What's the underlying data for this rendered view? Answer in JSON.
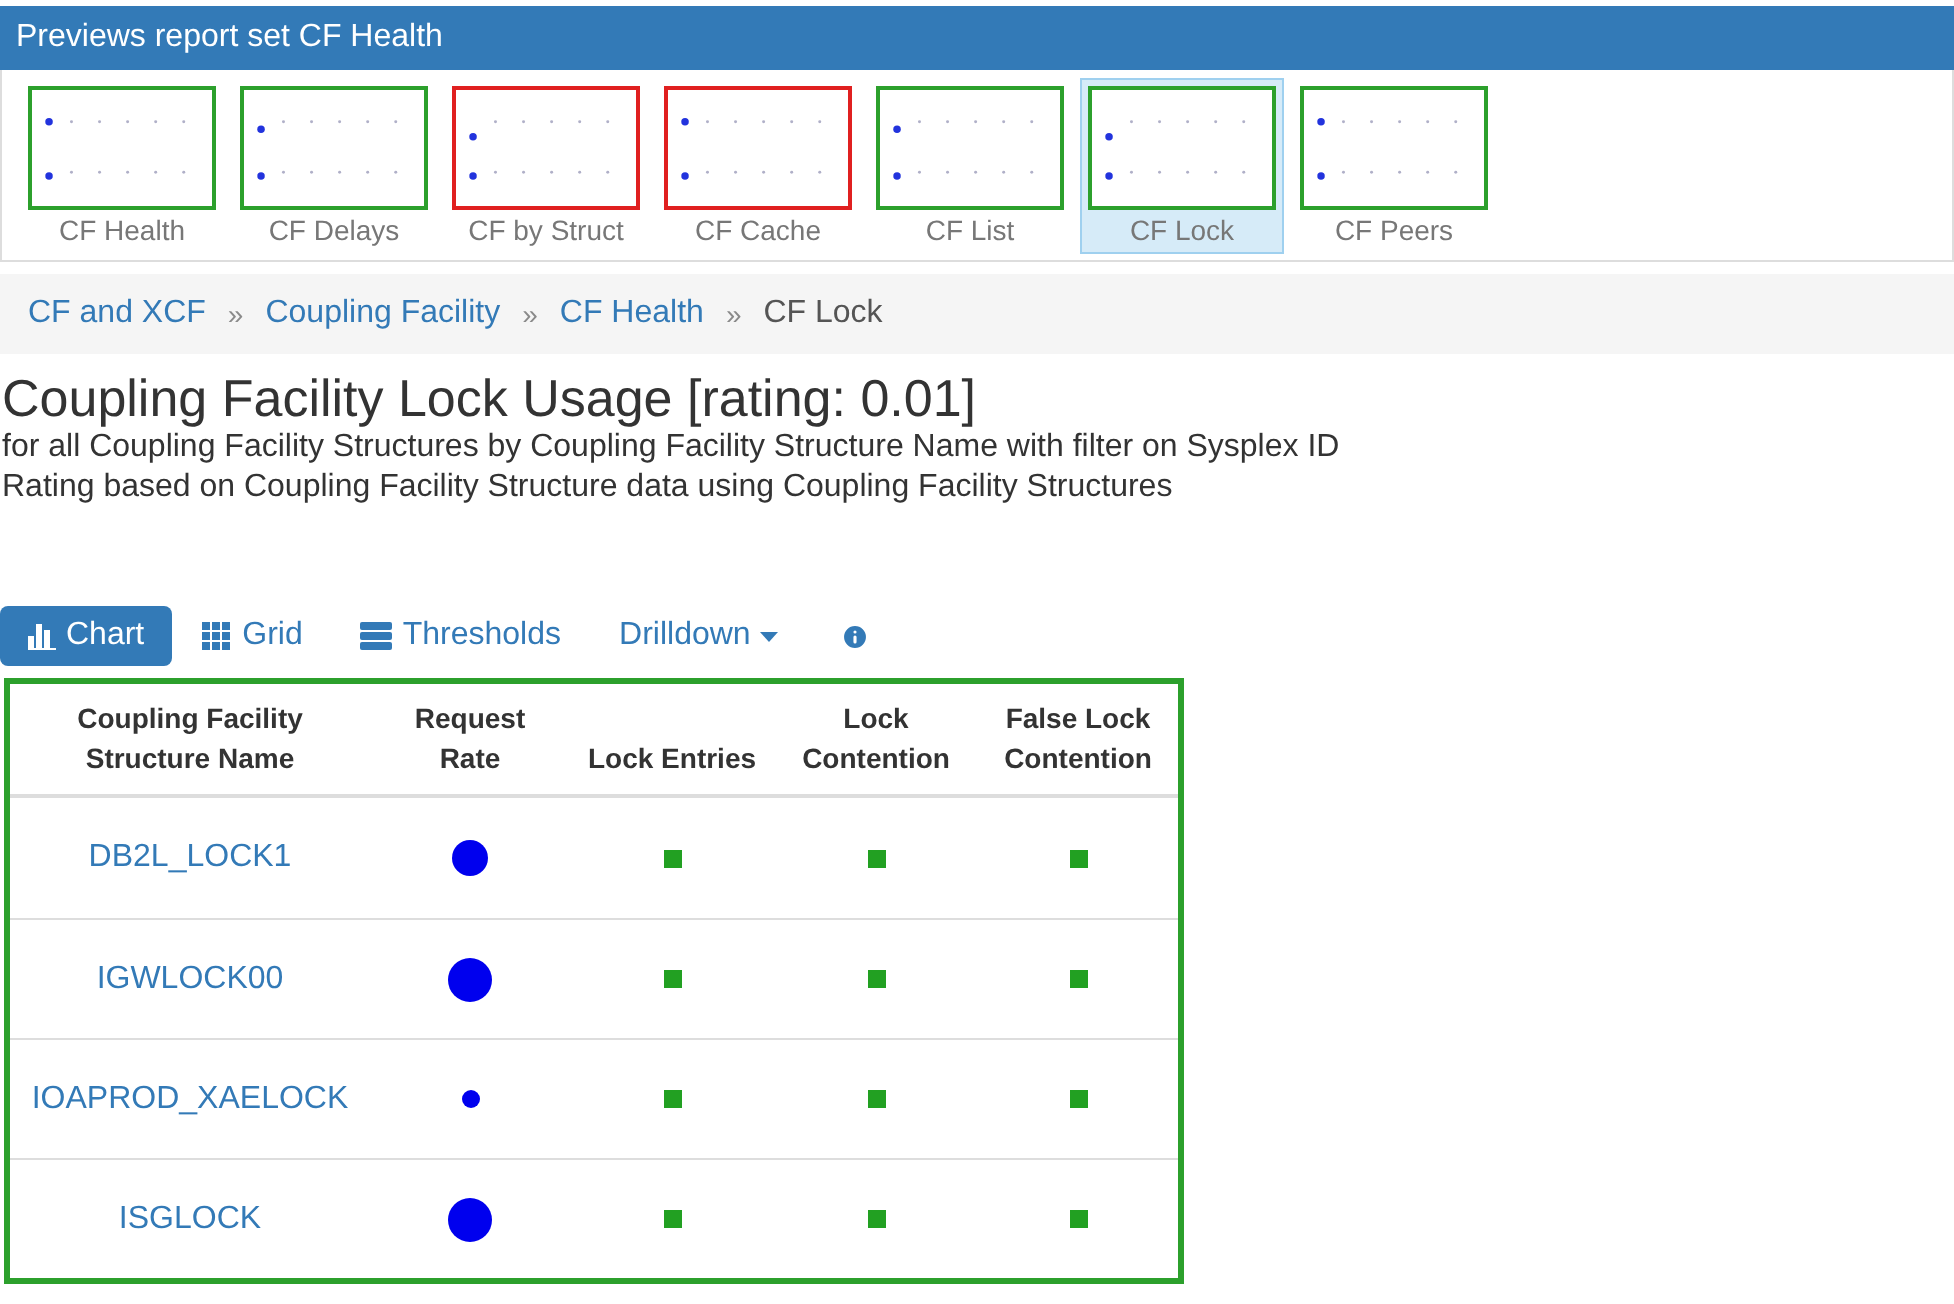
{
  "header": {
    "title": "Previews report set CF Health"
  },
  "thumbnails": [
    {
      "label": "CF Health",
      "color": "#2ca02c",
      "selected": false
    },
    {
      "label": "CF Delays",
      "color": "#2ca02c",
      "selected": false
    },
    {
      "label": "CF by Struct",
      "color": "#e02020",
      "selected": false
    },
    {
      "label": "CF Cache",
      "color": "#e02020",
      "selected": false
    },
    {
      "label": "CF List",
      "color": "#2ca02c",
      "selected": false
    },
    {
      "label": "CF Lock",
      "color": "#2ca02c",
      "selected": true
    },
    {
      "label": "CF Peers",
      "color": "#2ca02c",
      "selected": false
    }
  ],
  "breadcrumb": [
    {
      "label": "CF and XCF",
      "kind": "link"
    },
    {
      "label": "Coupling Facility",
      "kind": "link"
    },
    {
      "label": "CF Health",
      "kind": "link"
    },
    {
      "label": "CF Lock",
      "kind": "current"
    }
  ],
  "breadcrumb_separator": "»",
  "title": "Coupling Facility Lock Usage [rating: 0.01]",
  "subtitles": [
    "for all Coupling Facility Structures by Coupling Facility Structure Name with filter on Sysplex ID",
    "Rating based on Coupling Facility Structure data using Coupling Facility Structures"
  ],
  "toolbar": [
    {
      "label": "Chart",
      "kind": "chart",
      "selected": true
    },
    {
      "label": "Grid",
      "kind": "grid",
      "selected": false
    },
    {
      "label": "Thresholds",
      "kind": "thresholds",
      "selected": false
    },
    {
      "label": "Drilldown",
      "kind": "dropdown",
      "selected": false
    },
    {
      "kind": "info",
      "selected": false
    }
  ],
  "table": {
    "columns": [
      "Coupling Facility Structure Name",
      "Request Rate",
      "Lock Entries",
      "Lock Contention",
      "False Lock Contention"
    ],
    "rows": [
      {
        "name": "DB2L_LOCK1",
        "kind": "medium",
        "cells": [
          {
            "color": "#22a022"
          },
          {
            "color": "#22a022"
          },
          {
            "color": "#22a022"
          }
        ]
      },
      {
        "name": "IGWLOCK00",
        "kind": "large",
        "cells": [
          {
            "color": "#22a022"
          },
          {
            "color": "#22a022"
          },
          {
            "color": "#22a022"
          }
        ]
      },
      {
        "name": "IOAPROD_XAELOCK",
        "kind": "small",
        "cells": [
          {
            "color": "#22a022"
          },
          {
            "color": "#22a022"
          },
          {
            "color": "#22a022"
          }
        ]
      },
      {
        "name": "ISGLOCK",
        "kind": "large",
        "cells": [
          {
            "color": "#22a022"
          },
          {
            "color": "#22a022"
          },
          {
            "color": "#22a022"
          }
        ]
      }
    ]
  }
}
